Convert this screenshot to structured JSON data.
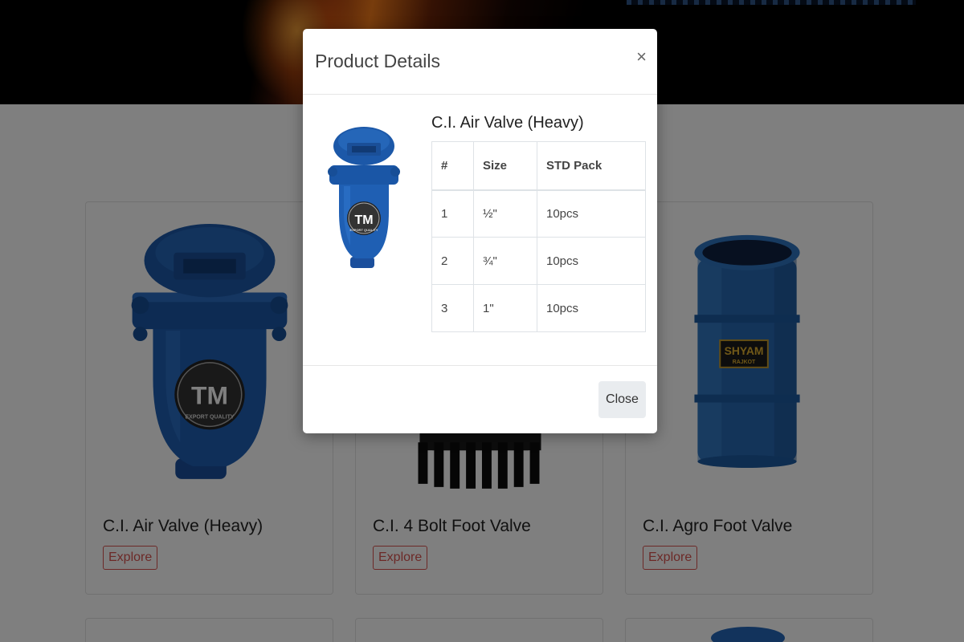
{
  "products": [
    {
      "title": "C.I. Air Valve (Heavy)",
      "explore_label": "Explore",
      "logo": "TM",
      "logo_sub": "EXPORT QUALITY"
    },
    {
      "title": "C.I. 4 Bolt Foot Valve",
      "explore_label": "Explore"
    },
    {
      "title": "C.I. Agro Foot Valve",
      "explore_label": "Explore",
      "logo": "SHYAM",
      "logo_sub": "RAJKOT"
    }
  ],
  "modal": {
    "title": "Product Details",
    "close_x": "×",
    "product_name": "C.I. Air Valve (Heavy)",
    "image_logo": "TM",
    "image_logo_sub": "EXPORT QUALITY",
    "table": {
      "headers": [
        "#",
        "Size",
        "STD Pack"
      ],
      "rows": [
        [
          "1",
          "½\"",
          "10pcs"
        ],
        [
          "2",
          "¾\"",
          "10pcs"
        ],
        [
          "3",
          "1\"",
          "10pcs"
        ]
      ]
    },
    "close_label": "Close"
  },
  "colors": {
    "valve_blue": "#1f5fb3",
    "explore_red": "#d9534f",
    "overlay": "rgba(0,0,0,0.5)"
  }
}
